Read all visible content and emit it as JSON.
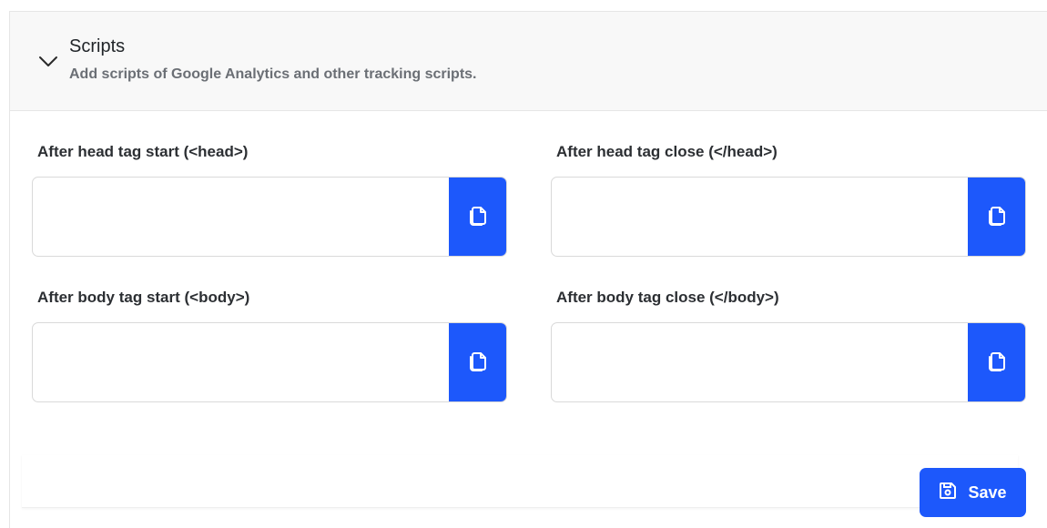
{
  "section": {
    "title": "Scripts",
    "subtitle": "Add scripts of Google Analytics and other tracking scripts."
  },
  "fields": [
    {
      "label": "After head tag start (<head>)",
      "value": ""
    },
    {
      "label": "After head tag close (</head>)",
      "value": ""
    },
    {
      "label": "After body tag start (<body>)",
      "value": ""
    },
    {
      "label": "After body tag close (</body>)",
      "value": ""
    }
  ],
  "icons": {
    "section_toggle": "chevron-down-icon",
    "copy": "copy-icon",
    "save": "floppy-disk-icon"
  },
  "save_label": "Save",
  "colors": {
    "accent": "#1d58fb",
    "header_bg": "#f8f8f8"
  }
}
